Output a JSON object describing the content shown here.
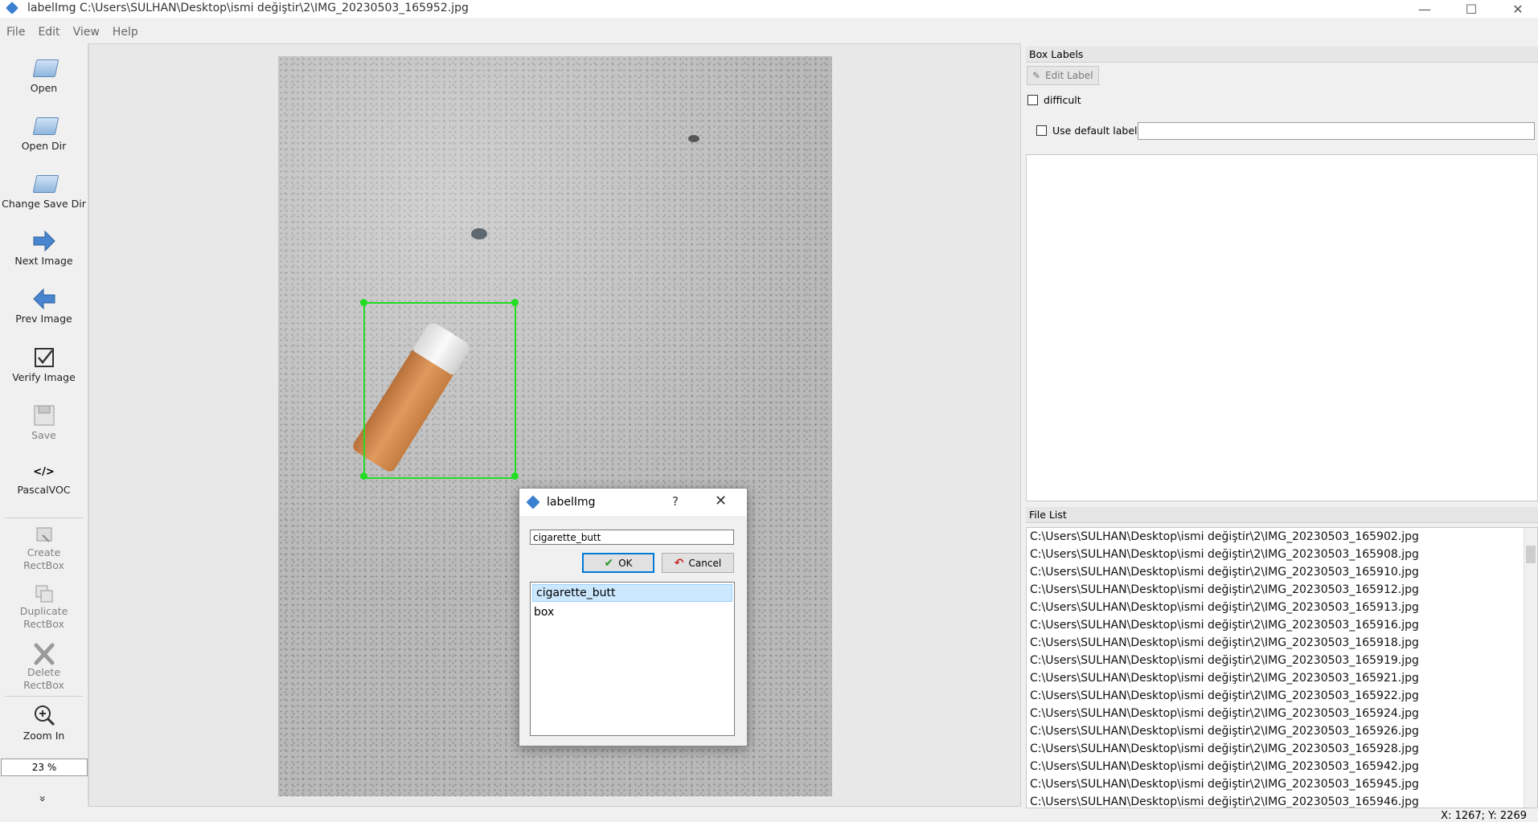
{
  "window": {
    "title": "labelImg C:\\Users\\SULHAN\\Desktop\\ismi değiştir\\2\\IMG_20230503_165952.jpg",
    "minimize": "—",
    "maximize": "☐",
    "close": "✕"
  },
  "menu": [
    "File",
    "Edit",
    "View",
    "Help"
  ],
  "toolbar": {
    "open": "Open",
    "open_dir": "Open Dir",
    "change_save_dir": "Change Save Dir",
    "next_image": "Next Image",
    "prev_image": "Prev Image",
    "verify_image": "Verify Image",
    "save": "Save",
    "format_icon": "</>",
    "format": "PascalVOC",
    "create_rectbox": "Create\nRectBox",
    "duplicate_rectbox": "Duplicate\nRectBox",
    "delete_rectbox": "Delete\nRectBox",
    "zoom_in": "Zoom In",
    "zoom_value": "23 %",
    "more": "»"
  },
  "dialog": {
    "title": "labelImg",
    "help": "?",
    "close": "✕",
    "input_value": "cigarette_butt",
    "ok": "OK",
    "cancel": "Cancel",
    "labels": [
      "cigarette_butt",
      "box"
    ]
  },
  "box_labels": {
    "title": "Box Labels",
    "edit_label": "Edit Label",
    "difficult": "difficult",
    "use_default_label": "Use default label"
  },
  "file_list": {
    "title": "File List",
    "files": [
      "C:\\Users\\SULHAN\\Desktop\\ismi değiştir\\2\\IMG_20230503_165902.jpg",
      "C:\\Users\\SULHAN\\Desktop\\ismi değiştir\\2\\IMG_20230503_165908.jpg",
      "C:\\Users\\SULHAN\\Desktop\\ismi değiştir\\2\\IMG_20230503_165910.jpg",
      "C:\\Users\\SULHAN\\Desktop\\ismi değiştir\\2\\IMG_20230503_165912.jpg",
      "C:\\Users\\SULHAN\\Desktop\\ismi değiştir\\2\\IMG_20230503_165913.jpg",
      "C:\\Users\\SULHAN\\Desktop\\ismi değiştir\\2\\IMG_20230503_165916.jpg",
      "C:\\Users\\SULHAN\\Desktop\\ismi değiştir\\2\\IMG_20230503_165918.jpg",
      "C:\\Users\\SULHAN\\Desktop\\ismi değiştir\\2\\IMG_20230503_165919.jpg",
      "C:\\Users\\SULHAN\\Desktop\\ismi değiştir\\2\\IMG_20230503_165921.jpg",
      "C:\\Users\\SULHAN\\Desktop\\ismi değiştir\\2\\IMG_20230503_165922.jpg",
      "C:\\Users\\SULHAN\\Desktop\\ismi değiştir\\2\\IMG_20230503_165924.jpg",
      "C:\\Users\\SULHAN\\Desktop\\ismi değiştir\\2\\IMG_20230503_165926.jpg",
      "C:\\Users\\SULHAN\\Desktop\\ismi değiştir\\2\\IMG_20230503_165928.jpg",
      "C:\\Users\\SULHAN\\Desktop\\ismi değiştir\\2\\IMG_20230503_165942.jpg",
      "C:\\Users\\SULHAN\\Desktop\\ismi değiştir\\2\\IMG_20230503_165945.jpg",
      "C:\\Users\\SULHAN\\Desktop\\ismi değiştir\\2\\IMG_20230503_165946.jpg"
    ]
  },
  "status": "X: 1267; Y: 2269",
  "colors": {
    "bbox": "#22dd22",
    "selected": "#cce8ff",
    "ok_border": "#0078d7"
  }
}
